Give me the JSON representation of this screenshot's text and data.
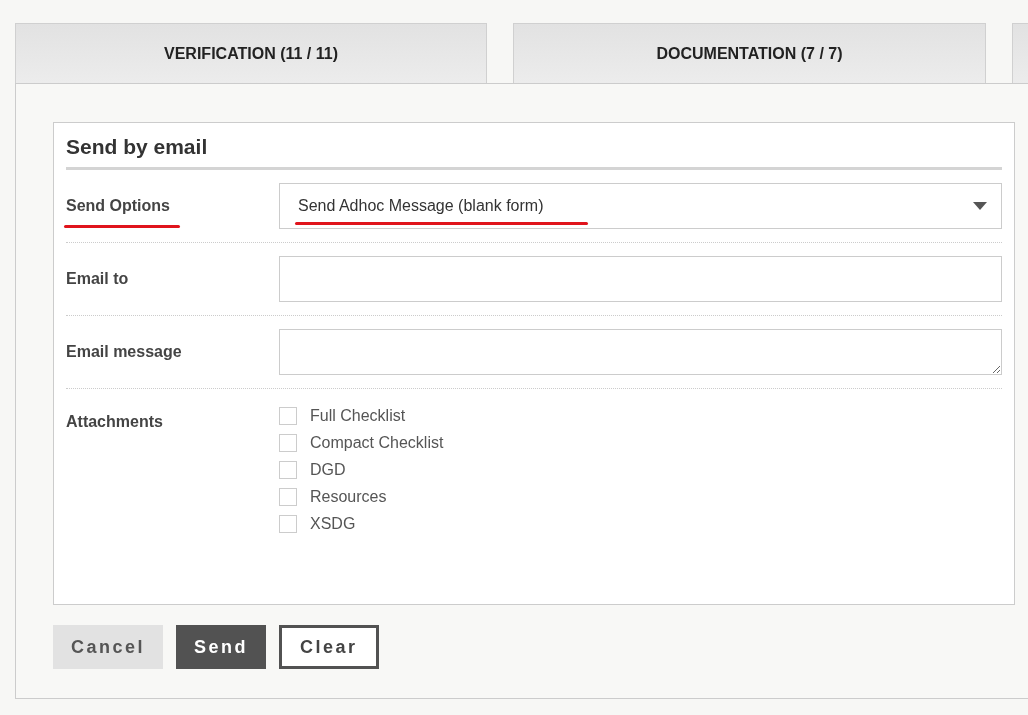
{
  "tabs": [
    {
      "label": "VERIFICATION (11 / 11)",
      "selected": false
    },
    {
      "label": "DOCUMENTATION (7 / 7)",
      "selected": false
    }
  ],
  "form": {
    "title": "Send by email",
    "send_options": {
      "label": "Send Options",
      "value": "Send Adhoc Message (blank form)",
      "highlighted": true
    },
    "email_to": {
      "label": "Email to"
    },
    "email_message": {
      "label": "Email message"
    },
    "attachments": {
      "label": "Attachments",
      "items": [
        {
          "label": "Full Checklist",
          "checked": false
        },
        {
          "label": "Compact Checklist",
          "checked": false
        },
        {
          "label": "DGD",
          "checked": false
        },
        {
          "label": "Resources",
          "checked": false
        },
        {
          "label": "XSDG",
          "checked": false
        }
      ]
    }
  },
  "buttons": [
    {
      "label": "Cancel",
      "kind": "secondary"
    },
    {
      "label": "Send",
      "kind": "primary"
    },
    {
      "label": "Clear",
      "kind": "outline"
    }
  ]
}
